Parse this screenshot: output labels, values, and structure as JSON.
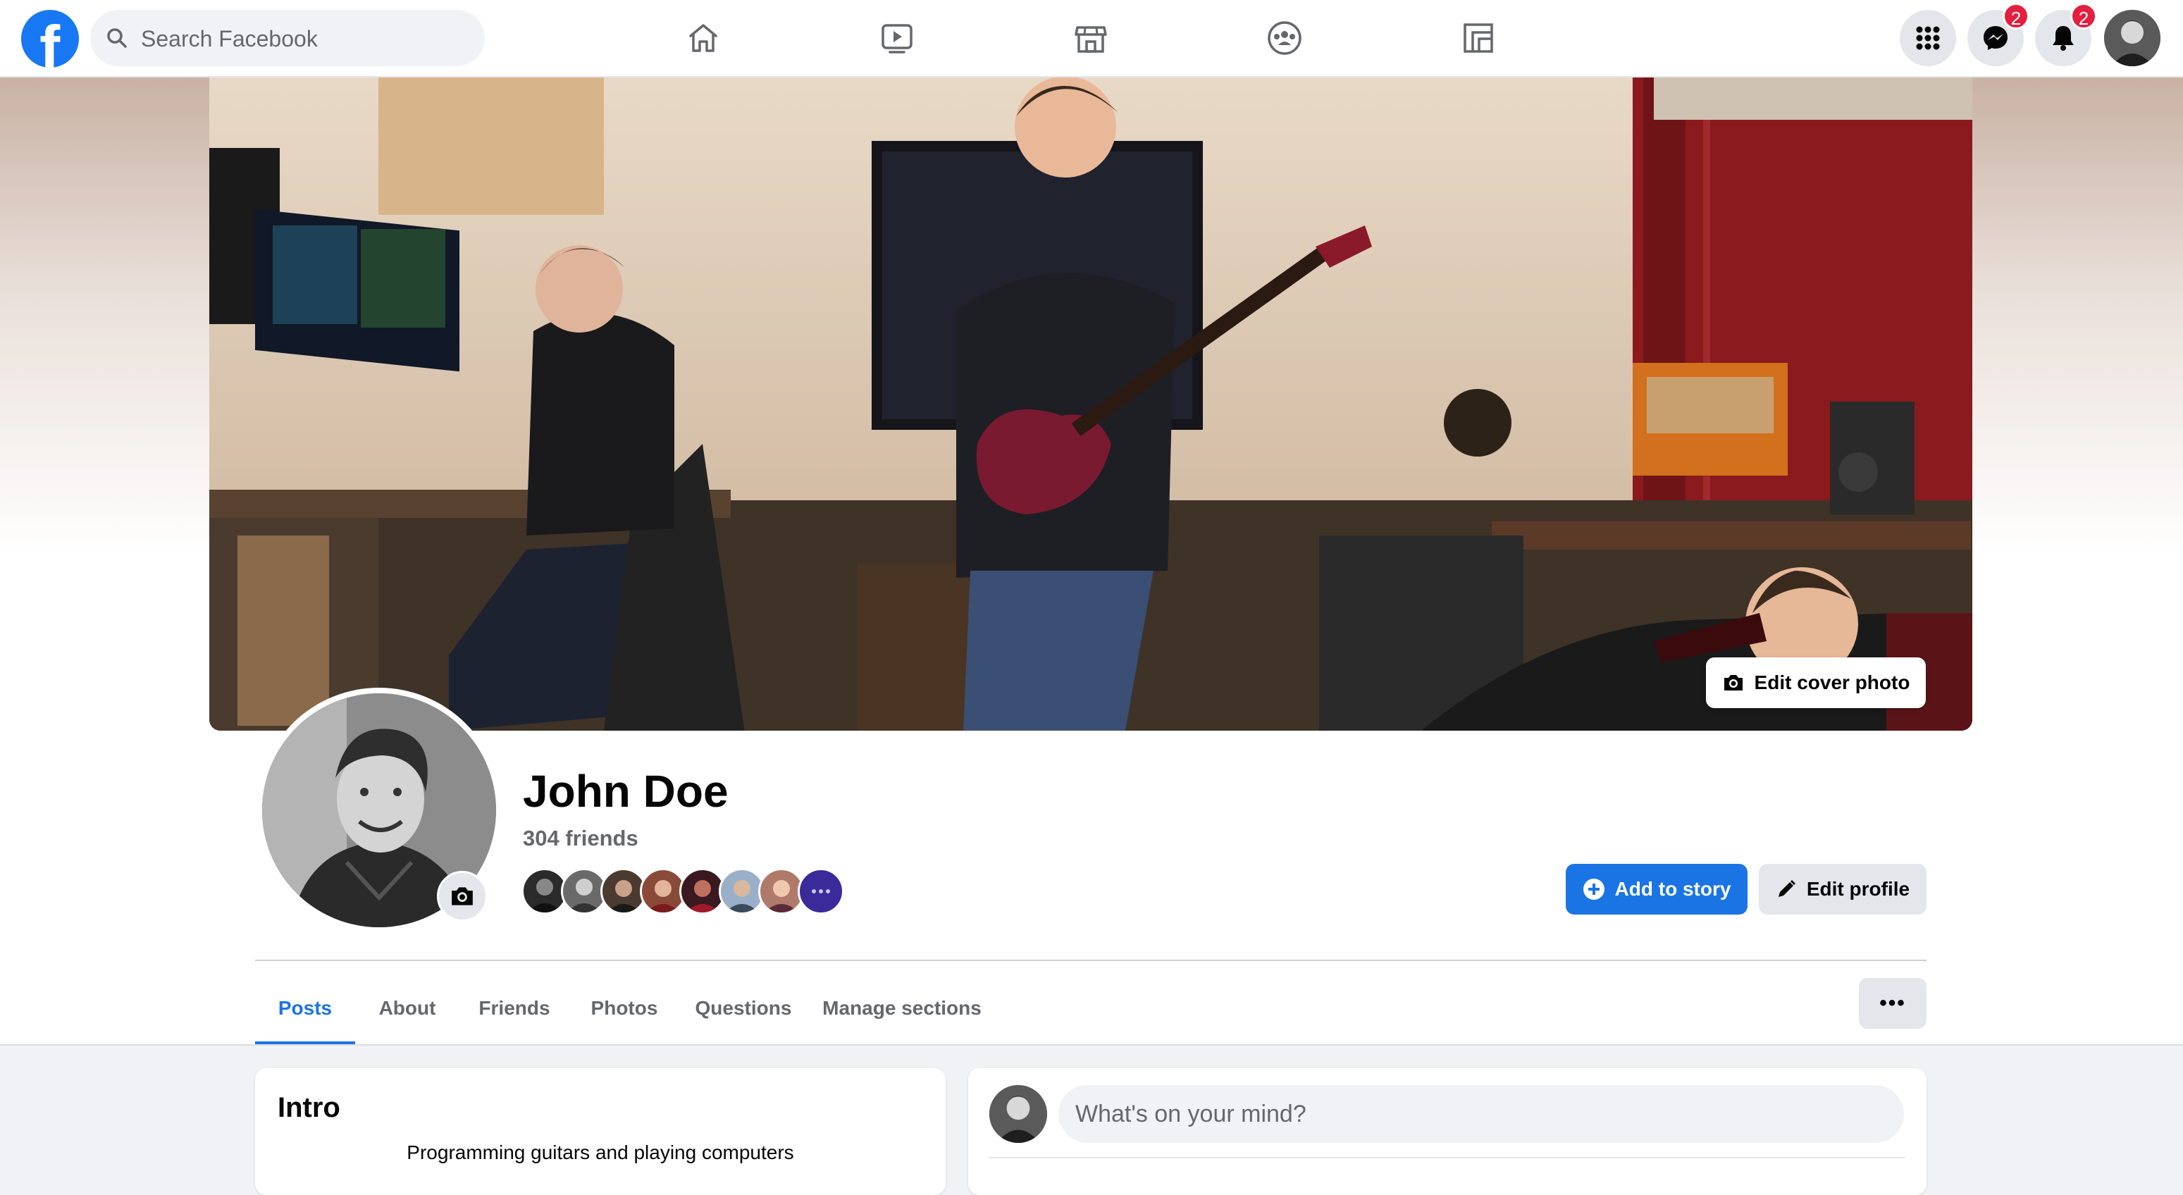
{
  "app": "Facebook",
  "topbar": {
    "logo_letter": "f",
    "search_placeholder": "Search Facebook",
    "nav_tabs": [
      "home-icon",
      "watch-icon",
      "marketplace-icon",
      "groups-icon",
      "gaming-icon"
    ],
    "menu_icon": "grid-menu-icon",
    "messenger": {
      "icon": "messenger-icon",
      "badge": "2"
    },
    "notifications": {
      "icon": "bell-icon",
      "badge": "2"
    },
    "account_icon": "profile-avatar"
  },
  "cover": {
    "edit_label": "Edit cover photo",
    "edit_icon": "camera-icon"
  },
  "profile": {
    "name": "John Doe",
    "friends_count": "304 friends",
    "friend_faces": 8,
    "camera_icon": "camera-icon"
  },
  "actions": {
    "add_story": "Add to story",
    "edit_profile": "Edit profile",
    "more": "•••"
  },
  "tabs": [
    {
      "label": "Posts",
      "active": true
    },
    {
      "label": "About",
      "active": false
    },
    {
      "label": "Friends",
      "active": false
    },
    {
      "label": "Photos",
      "active": false
    },
    {
      "label": "Questions",
      "active": false
    },
    {
      "label": "Manage sections",
      "active": false
    }
  ],
  "intro": {
    "title": "Intro",
    "bio": "Programming guitars and playing computers"
  },
  "composer": {
    "placeholder": "What's on your mind?"
  },
  "colors": {
    "brand": "#1877f2",
    "accent": "#1b74e4",
    "badge": "#e41e3f",
    "secondary_text": "#65676b",
    "button_gray": "#e4e6eb",
    "page_bg": "#f0f2f5"
  }
}
